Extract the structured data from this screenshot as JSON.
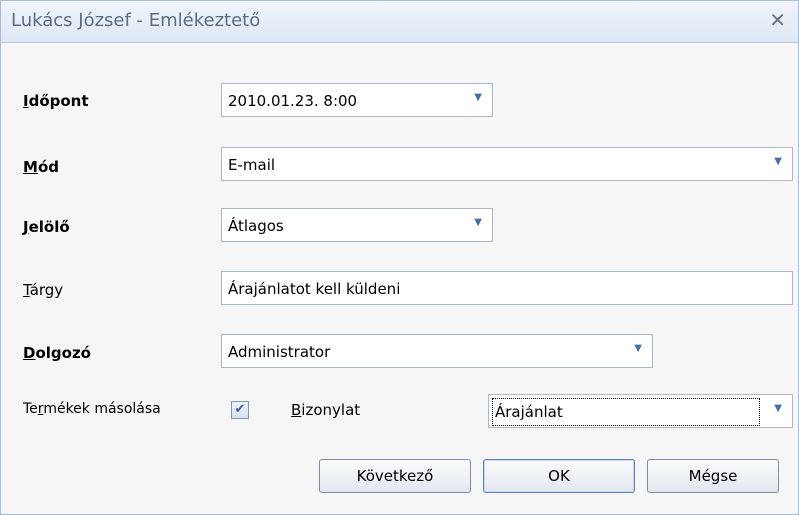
{
  "window": {
    "title": "Lukács József - Emlékeztető",
    "close_glyph": "✕"
  },
  "fields": {
    "idopont": {
      "label_ul": "I",
      "label_rest": "dőpont",
      "value": "2010.01.23. 8:00"
    },
    "mod": {
      "label_ul": "M",
      "label_rest": "ód",
      "value": "E-mail"
    },
    "jelolo": {
      "label_ul": "J",
      "label_rest": "elölő",
      "value": "Átlagos"
    },
    "targy": {
      "label_pre": "",
      "label_ul": "T",
      "label_rest": "árgy",
      "value": "Árajánlatot kell küldeni"
    },
    "dolgozo": {
      "label_ul": "D",
      "label_rest": "olgozó",
      "value": "Administrator"
    },
    "termekek": {
      "label_pre": "Te",
      "label_ul": "r",
      "label_rest": "mékek másolása",
      "checked": true,
      "check_glyph": "✔"
    },
    "bizonylat": {
      "label_ul": "B",
      "label_rest": "izonylat",
      "value": "Árajánlat"
    }
  },
  "buttons": {
    "next": "Következő",
    "ok": "OK",
    "cancel": "Mégse"
  },
  "arrow_glyph": "▼"
}
